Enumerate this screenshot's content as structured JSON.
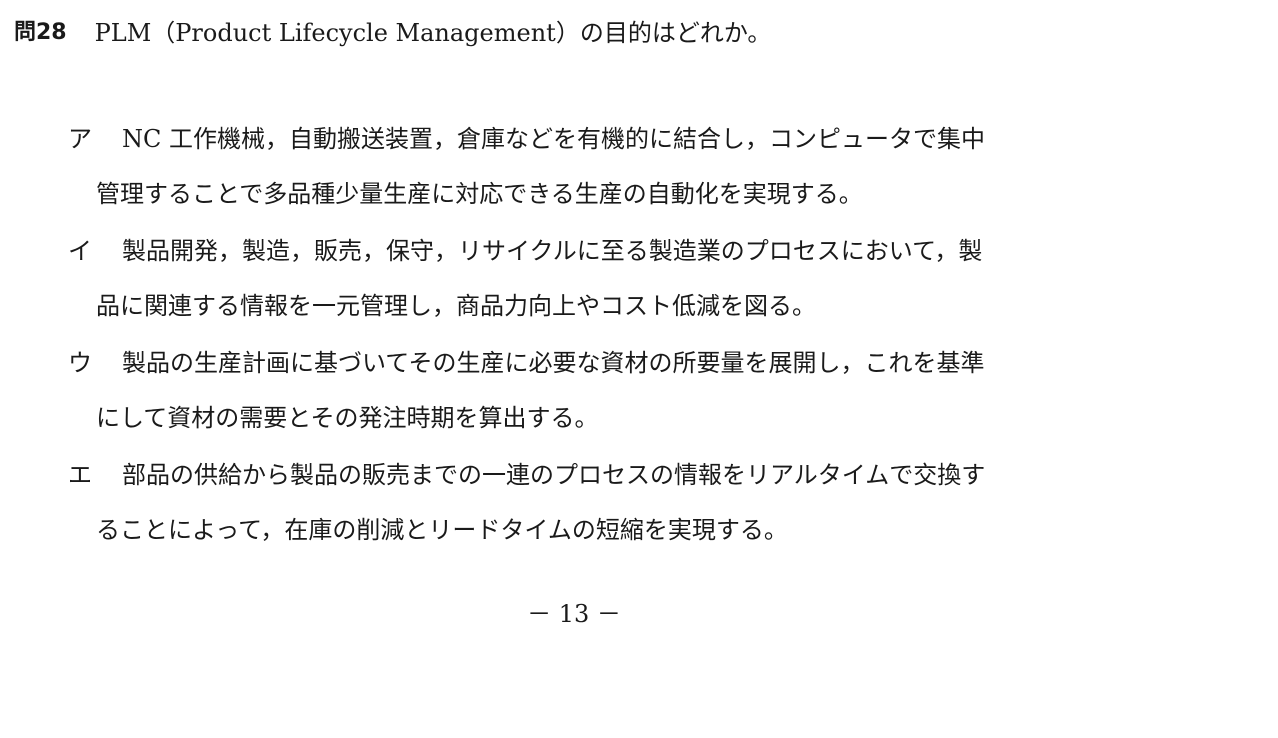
{
  "question": {
    "number": "問28",
    "text": "PLM（Product Lifecycle Management）の目的はどれか。"
  },
  "choices": [
    {
      "label": "ア",
      "lines": [
        "NC 工作機械，自動搬送装置，倉庫などを有機的に結合し，コンピュータで集中",
        "管理することで多品種少量生産に対応できる生産の自動化を実現する。"
      ]
    },
    {
      "label": "イ",
      "lines": [
        "製品開発，製造，販売，保守，リサイクルに至る製造業のプロセスにおいて，製",
        "品に関連する情報を一元管理し，商品力向上やコスト低減を図る。"
      ]
    },
    {
      "label": "ウ",
      "lines": [
        "製品の生産計画に基づいてその生産に必要な資材の所要量を展開し，これを基準",
        "にして資材の需要とその発注時期を算出する。"
      ]
    },
    {
      "label": "エ",
      "lines": [
        "部品の供給から製品の販売までの一連のプロセスの情報をリアルタイムで交換す",
        "ることによって，在庫の削減とリードタイムの短縮を実現する。"
      ]
    }
  ],
  "page_number": "－ 13 －"
}
